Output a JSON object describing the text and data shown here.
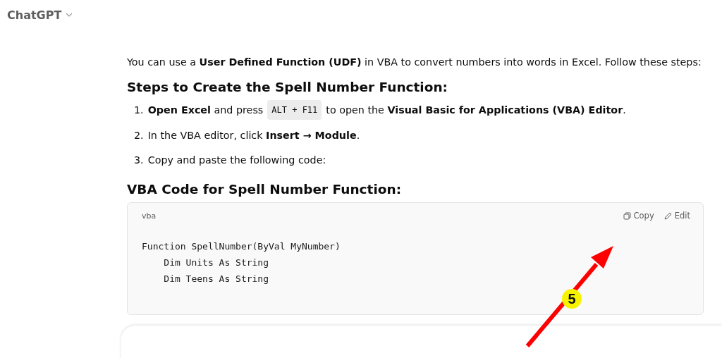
{
  "header": {
    "title": "ChatGPT"
  },
  "intro": "You can use a **User Defined Function (UDF)** in VBA to convert numbers into words in Excel. Follow these steps:",
  "heading_1": "Steps to Create the Spell Number Function:",
  "steps": [
    {
      "number": "1.",
      "parts": [
        {
          "kind": "text",
          "text": "**Open Excel** and press"
        },
        {
          "kind": "code",
          "text": "ALT + F11"
        },
        {
          "kind": "text",
          "text": "to open the **Visual Basic for Applications (VBA) Editor**."
        }
      ]
    },
    {
      "number": "2.",
      "parts": [
        {
          "kind": "text",
          "text": "In the VBA editor, click **Insert → Module**."
        }
      ]
    },
    {
      "number": "3.",
      "parts": [
        {
          "kind": "text",
          "text": "Copy and paste the following code:"
        }
      ]
    }
  ],
  "heading_2": "VBA Code for Spell Number Function:",
  "code_block": {
    "language": "vba",
    "copy_label": "Copy",
    "edit_label": "Edit",
    "lines": [
      "Function SpellNumber(ByVal MyNumber)",
      "    Dim Units As String",
      "    Dim Teens As String"
    ]
  },
  "annotation": {
    "badge": "5"
  }
}
